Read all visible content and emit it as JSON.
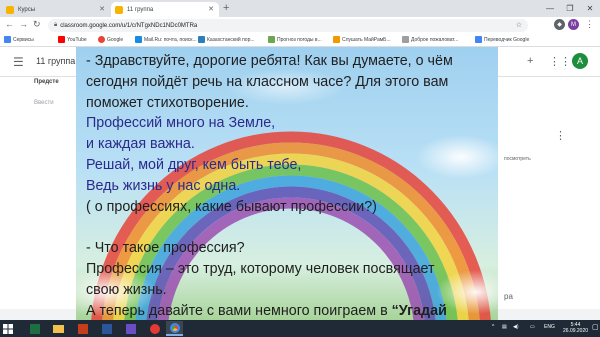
{
  "browser": {
    "tabs": [
      {
        "title": "Курсы",
        "active": false
      },
      {
        "title": "11 группа",
        "active": true
      }
    ],
    "url": "classroom.google.com/u/1/c/NTgxNDc1NDc0MTRa",
    "bookmarks": [
      "Сервисы",
      "YouTube",
      "Google",
      "Mail.Ru: почта, поиск...",
      "Казахстанский пор...",
      "Прогноз погоды в...",
      "Слушать МайРамБ...",
      "Доброе пожаловат...",
      "Переводчик Google"
    ],
    "extensions": [
      "M"
    ],
    "profile_initial": "M"
  },
  "classroom": {
    "title": "11 группа",
    "avatar_initial": "A",
    "side_left_1": "Предсте",
    "side_left_2": "Ввести",
    "side_right_1": "посмотреть",
    "side_right_2": "ра"
  },
  "slide": {
    "lines": [
      {
        "text": "- Здравствуйте, дорогие ребята! Как вы думаете, о чём",
        "style": "normal"
      },
      {
        "text": "сегодня пойдёт речь на классном часе?  Для этого вам",
        "style": "normal"
      },
      {
        "text": "поможет  стихотворение.",
        "style": "normal"
      },
      {
        "text": "Профессий много на Земле,",
        "style": "blue"
      },
      {
        "text": "и каждая важна.",
        "style": "blue"
      },
      {
        "text": "Решай, мой друг, кем быть тебе,",
        "style": "blue"
      },
      {
        "text": "Ведь жизнь у нас одна.",
        "style": "blue"
      },
      {
        "text": "( о профессиях, какие бывают профессии?)",
        "style": "normal"
      },
      {
        "text": "",
        "style": "gap"
      },
      {
        "text": "- Что такое профессия?",
        "style": "normal"
      },
      {
        "text": "   Профессия – это труд, которому человек посвящает",
        "style": "normal"
      },
      {
        "text": "свою жизнь.",
        "style": "normal"
      },
      {
        "text": "   А теперь давайте с вами немного поиграем в ",
        "style": "normal",
        "bold_tail": "“Угадай"
      }
    ]
  },
  "taskbar": {
    "language": "ENG",
    "time": "5:44",
    "date": "26.09.2020"
  },
  "colors": {
    "chrome_bg": "#dee1e6",
    "taskbar_bg": "#1f2a36",
    "slide_blue_text": "#2b2a8c",
    "avatar_green": "#1e8e3e"
  }
}
